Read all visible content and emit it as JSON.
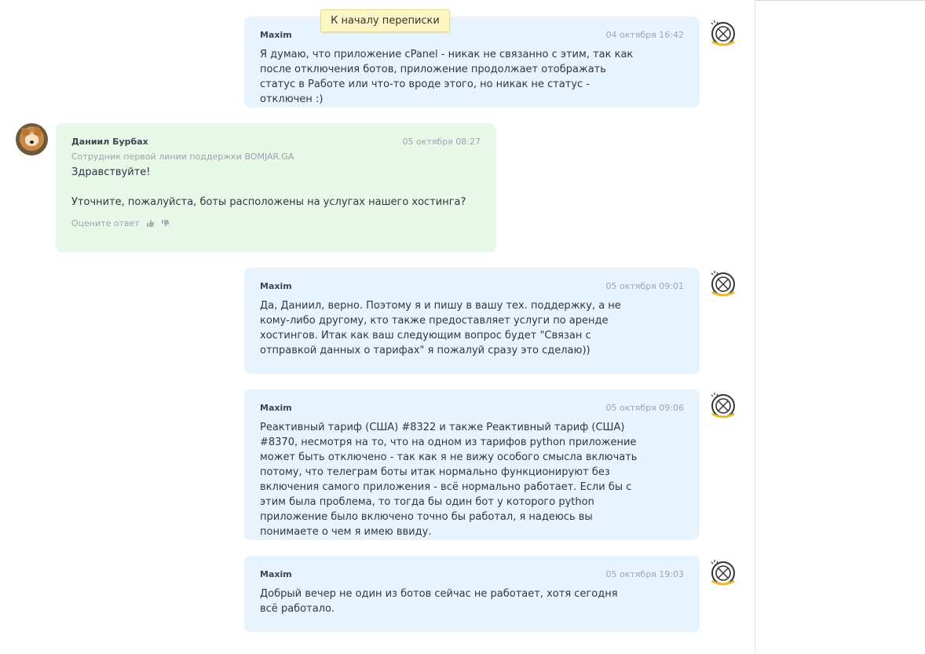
{
  "jump_button": {
    "label": "К началу переписки"
  },
  "messages": [
    {
      "author": "Maxim",
      "date": "04 октября 16:42",
      "paragraphs": [
        "Я думаю, что приложение cPanel - никак не связанно с этим, так как после отключения ботов, приложение продолжает отображать статус в Работе или что-то вроде этого, но никак не статус - отключен :)"
      ]
    },
    {
      "author": "Даниил Бурбах",
      "date": "05 октября 08:27",
      "role": "Сотрудник первой линии поддержки BOMJAR.GA",
      "paragraphs": [
        "Здравствуйте!",
        "Уточните, пожалуйста, боты расположены на услугах нашего хостинга?"
      ],
      "rate_label": "Оцените ответ"
    },
    {
      "author": "Maxim",
      "date": "05 октября 09:01",
      "paragraphs": [
        "Да, Даниил, верно. Поэтому я и пишу в вашу тех. поддержку, а не кому-либо другому, кто также предоставляет услуги по аренде хостингов. Итак как ваш следующим вопрос будет \"Связан с отправкой данных о тарифах\" я пожалуй сразу это сделаю))"
      ]
    },
    {
      "author": "Maxim",
      "date": "05 октября 09:06",
      "paragraphs": [
        "Реактивный тариф (США) #8322 и также Реактивный тариф (США) #8370, несмотря на то, что на одном из тарифов python приложение может быть отключено - так как я не вижу особого смысла включать потому, что телеграм боты итак нормально функционируют без включения самого приложения - всё нормально работает. Если бы с этим была проблема, то тогда бы один бот у которого python приложение было включено точно бы работал, я надеюсь вы понимаете о чем я имею ввиду."
      ]
    },
    {
      "author": "Maxim",
      "date": "05 октября 19:03",
      "paragraphs": [
        "Добрый вечер не один из ботов сейчас не работает, хотя сегодня всё работало."
      ]
    }
  ],
  "icons": {
    "user_avatar": "robot-avatar-icon",
    "staff_avatar": "dog-avatar",
    "like": "thumbs-up-icon",
    "dislike": "thumbs-down-icon"
  },
  "colors": {
    "user_bubble": "#e8f4fd",
    "staff_bubble": "#e8f8e8",
    "jump_button_bg": "#fdf6c5"
  }
}
